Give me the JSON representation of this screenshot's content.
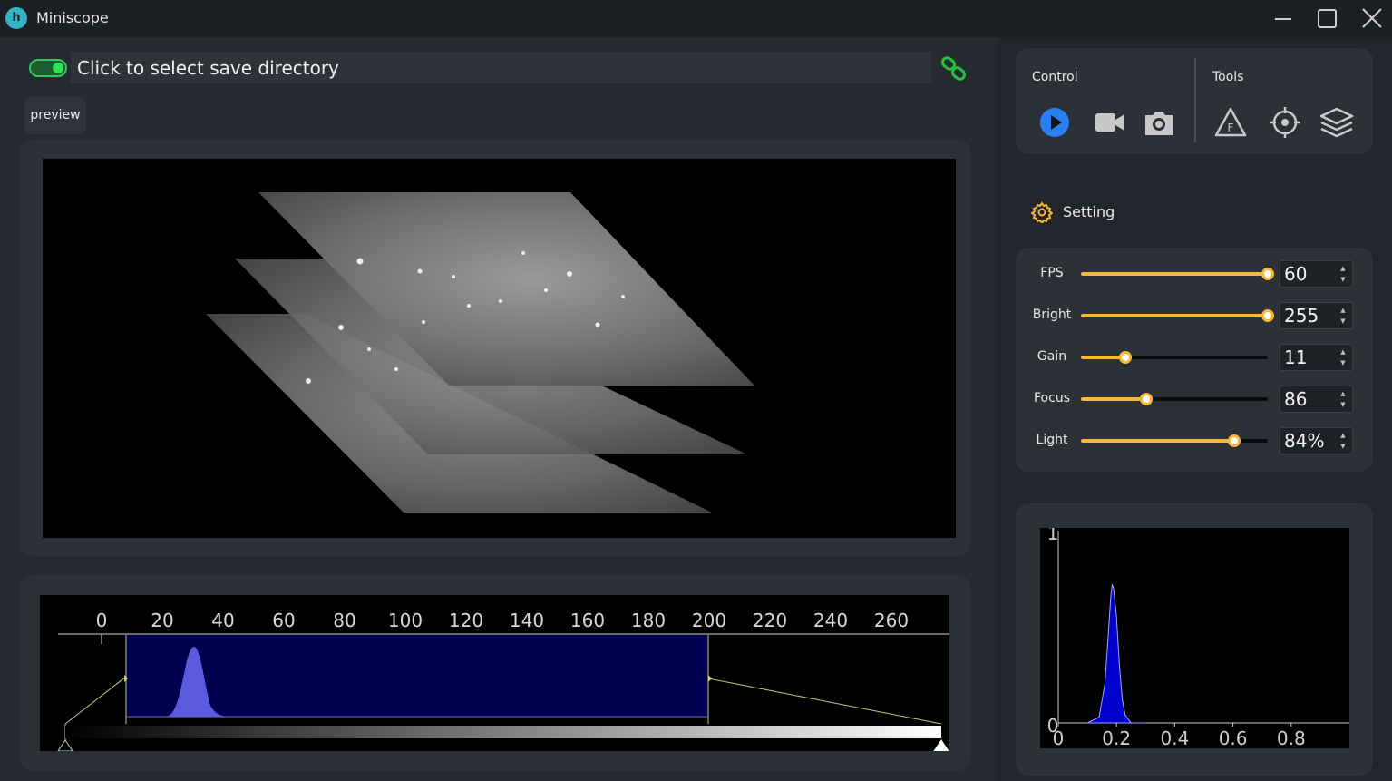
{
  "window": {
    "title": "Miniscope",
    "icon_letter": "h"
  },
  "save_bar": {
    "recording_enabled": true,
    "path_placeholder": "Click to select save directory"
  },
  "tabs": {
    "preview_label": "preview"
  },
  "tools": {
    "control_label": "Control",
    "tools_label": "Tools",
    "control_buttons": [
      "play-icon",
      "video-camera-icon",
      "camera-icon"
    ],
    "tool_buttons": [
      "focus-warning-icon",
      "crosshair-icon",
      "layers-icon"
    ]
  },
  "setting": {
    "title": "Setting",
    "accent": "#f6b835",
    "items": [
      {
        "label": "FPS",
        "value": "60",
        "level": 1.0
      },
      {
        "label": "Bright",
        "value": "255",
        "level": 1.0
      },
      {
        "label": "Gain",
        "value": "11",
        "level": 0.24
      },
      {
        "label": "Focus",
        "value": "86",
        "level": 0.35
      },
      {
        "label": "Light",
        "value": "84%",
        "level": 0.82
      }
    ]
  },
  "levels_histogram": {
    "ticks": [
      "0",
      "20",
      "40",
      "60",
      "80",
      "100",
      "120",
      "140",
      "160",
      "180",
      "200",
      "220",
      "240",
      "260"
    ]
  },
  "chart_data": {
    "type": "area",
    "x_ticks": [
      "0",
      "0.2",
      "0.4",
      "0.6",
      "0.8"
    ],
    "y_ticks": [
      "0",
      "1"
    ],
    "xlim": [
      0,
      1
    ],
    "ylim": [
      0,
      1
    ],
    "color": "#0000cc",
    "x": [
      0.1,
      0.14,
      0.16,
      0.17,
      0.18,
      0.185,
      0.19,
      0.2,
      0.21,
      0.22,
      0.23,
      0.25,
      0.3
    ],
    "y": [
      0.0,
      0.03,
      0.2,
      0.42,
      0.65,
      0.72,
      0.7,
      0.55,
      0.3,
      0.12,
      0.04,
      0.0,
      0.0
    ]
  }
}
